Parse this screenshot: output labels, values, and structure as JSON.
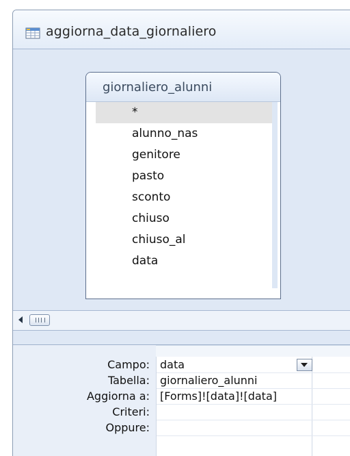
{
  "window": {
    "title": "aggiorna_data_giornaliero",
    "title_icon": "query-design-icon"
  },
  "table_box": {
    "name": "giornaliero_alunni",
    "fields": [
      "*",
      "alunno_nas",
      "genitore",
      "pasto",
      "sconto",
      "chiuso",
      "chiuso_al",
      "data"
    ],
    "selected_field_index": 0
  },
  "scrollbar": {
    "left_arrow_icon": "scroll-left-arrow-icon",
    "thumb_icon": "scroll-thumb-grip-icon"
  },
  "grid": {
    "row_labels": {
      "campo": "Campo:",
      "tabella": "Tabella:",
      "aggiorna": "Aggiorna a:",
      "criteri": "Criteri:",
      "oppure": "Oppure:"
    },
    "column_1": {
      "campo": "data",
      "tabella": "giornaliero_alunni",
      "aggiorna": "[Forms]![data]![data]",
      "criteri": "",
      "oppure": ""
    },
    "dropdown_icon": "dropdown-arrow-icon"
  },
  "colors": {
    "frame_background": "#dfe8f5",
    "border": "#8c9db4",
    "selection": "#e3e3e3"
  }
}
